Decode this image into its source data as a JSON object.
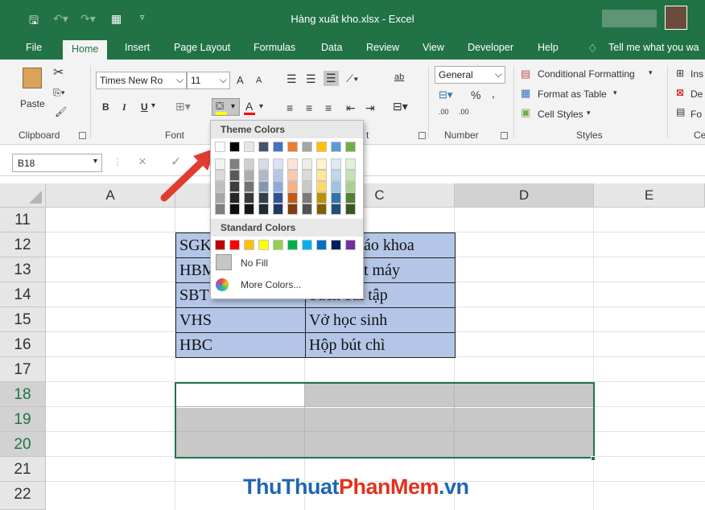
{
  "window": {
    "title": "Hàng xuất kho.xlsx  -  Excel"
  },
  "tabs": [
    "File",
    "Home",
    "Insert",
    "Page Layout",
    "Formulas",
    "Data",
    "Review",
    "View",
    "Developer",
    "Help"
  ],
  "tellme": "Tell me what you wa",
  "ribbon": {
    "paste": "Paste",
    "font_name": "Times New Ro",
    "font_size": "11",
    "bold": "B",
    "italic": "I",
    "underline": "U",
    "grow": "A",
    "shrink": "A",
    "font_color": "A",
    "number_format": "General",
    "percent": "%",
    "comma": ",",
    "wrap": "ab",
    "dec_up": ".00",
    "dec_down": ".00",
    "conditional": "Conditional Formatting",
    "format_table": "Format as Table",
    "cell_styles": "Cell Styles",
    "cells_insert": "Ins",
    "cells_delete": "De",
    "cells_format": "Fo",
    "groups": {
      "clipboard": "Clipboard",
      "font": "Font",
      "alignment": "t",
      "number": "Number",
      "styles": "Styles",
      "cells": "Ce"
    }
  },
  "formula_bar": {
    "name_box": "B18",
    "cancel": "×",
    "enter": "✓"
  },
  "columns": [
    "A",
    "C",
    "D",
    "E"
  ],
  "rows": [
    "11",
    "12",
    "13",
    "14",
    "15",
    "16",
    "17",
    "18",
    "19",
    "20",
    "21",
    "22"
  ],
  "table": [
    {
      "code": "SGK",
      "name": "áo khoa"
    },
    {
      "code": "HBM",
      "name": "t máy"
    },
    {
      "code": "SBT",
      "name": "Sách bài tập"
    },
    {
      "code": "VHS",
      "name": "Vở học sinh"
    },
    {
      "code": "HBC",
      "name": "Hộp bút chì"
    }
  ],
  "dropdown": {
    "theme_header": "Theme Colors",
    "standard_header": "Standard Colors",
    "no_fill": "No Fill",
    "more_colors": "More Colors..."
  },
  "theme_colors": [
    "#ffffff",
    "#000000",
    "#e7e6e6",
    "#44546a",
    "#4472c4",
    "#ed7d31",
    "#a5a5a5",
    "#ffc000",
    "#5b9bd5",
    "#70ad47"
  ],
  "theme_shades": [
    [
      "#f2f2f2",
      "#7f7f7f",
      "#d0cece",
      "#d6dce5",
      "#dae3f3",
      "#fbe5d6",
      "#ededed",
      "#fff2cc",
      "#deebf7",
      "#e2f0d9"
    ],
    [
      "#d9d9d9",
      "#595959",
      "#aeabab",
      "#adb9ca",
      "#b4c7e7",
      "#f8cbad",
      "#dbdbdb",
      "#ffe699",
      "#bdd7ee",
      "#c5e0b4"
    ],
    [
      "#bfbfbf",
      "#404040",
      "#757171",
      "#8497b0",
      "#8faadc",
      "#f4b183",
      "#c9c9c9",
      "#ffd966",
      "#9dc3e6",
      "#a9d18e"
    ],
    [
      "#a6a6a6",
      "#262626",
      "#3b3838",
      "#333f50",
      "#2f5597",
      "#c55a11",
      "#7b7b7b",
      "#bf9000",
      "#2e75b6",
      "#538135"
    ],
    [
      "#7f7f7f",
      "#0d0d0d",
      "#171616",
      "#222a35",
      "#1f3864",
      "#843c0c",
      "#525252",
      "#7f6000",
      "#1f4e79",
      "#375623"
    ]
  ],
  "standard_colors": [
    "#c00000",
    "#ff0000",
    "#ffc000",
    "#ffff00",
    "#92d050",
    "#00b050",
    "#00b0f0",
    "#0070c0",
    "#002060",
    "#7030a0"
  ],
  "watermark": {
    "part1": "ThuThuat",
    "part2": "PhanMem",
    "part3": ".vn"
  }
}
